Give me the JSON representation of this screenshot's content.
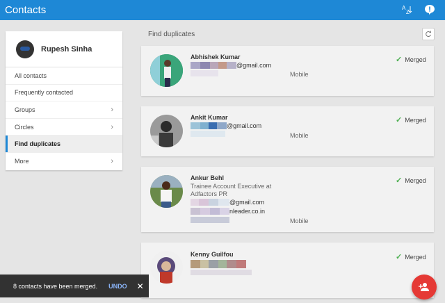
{
  "app": {
    "title": "Contacts"
  },
  "toolbar": {
    "sort_top": "A",
    "sort_bottom": "Z",
    "sort_icon": "sort-az-icon",
    "feedback_icon": "feedback-icon"
  },
  "sidebar": {
    "user_name": "Rupesh Sinha",
    "items": [
      {
        "label": "All contacts",
        "chevron": false,
        "active": false
      },
      {
        "label": "Frequently contacted",
        "chevron": false,
        "active": false
      },
      {
        "label": "Groups",
        "chevron": true,
        "active": false
      },
      {
        "label": "Circles",
        "chevron": true,
        "active": false
      },
      {
        "label": "Find duplicates",
        "chevron": false,
        "active": true
      },
      {
        "label": "More",
        "chevron": true,
        "active": false
      }
    ]
  },
  "main": {
    "section_title": "Find duplicates",
    "refresh_icon": "refresh-icon",
    "contacts": [
      {
        "name": "Abhishek Kumar",
        "subtitle": "",
        "email_suffix": "@gmail.com",
        "email2_suffix": "",
        "phone_type": "Mobile",
        "status": "Merged"
      },
      {
        "name": "Ankit Kumar",
        "subtitle": "",
        "email_suffix": "@gmail.com",
        "email2_suffix": "",
        "phone_type": "Mobile",
        "status": "Merged"
      },
      {
        "name": "Ankur Behl",
        "subtitle": "Trainee Account Executive at Adfactors PR",
        "email_suffix": "@gmail.com",
        "email2_suffix": "nleader.co.in",
        "phone_type": "Mobile",
        "status": "Merged"
      },
      {
        "name": "Kenny Guilfou",
        "subtitle": "",
        "email_suffix": "",
        "email2_suffix": "",
        "phone_type": "",
        "status": "Merged"
      }
    ]
  },
  "snackbar": {
    "message": "8 contacts have been merged.",
    "undo_label": "UNDO",
    "close_glyph": "✕"
  },
  "fab": {
    "icon": "add-person-icon"
  },
  "colors": {
    "primary": "#1e88d6",
    "fab": "#e53935",
    "check": "#4caf50"
  }
}
